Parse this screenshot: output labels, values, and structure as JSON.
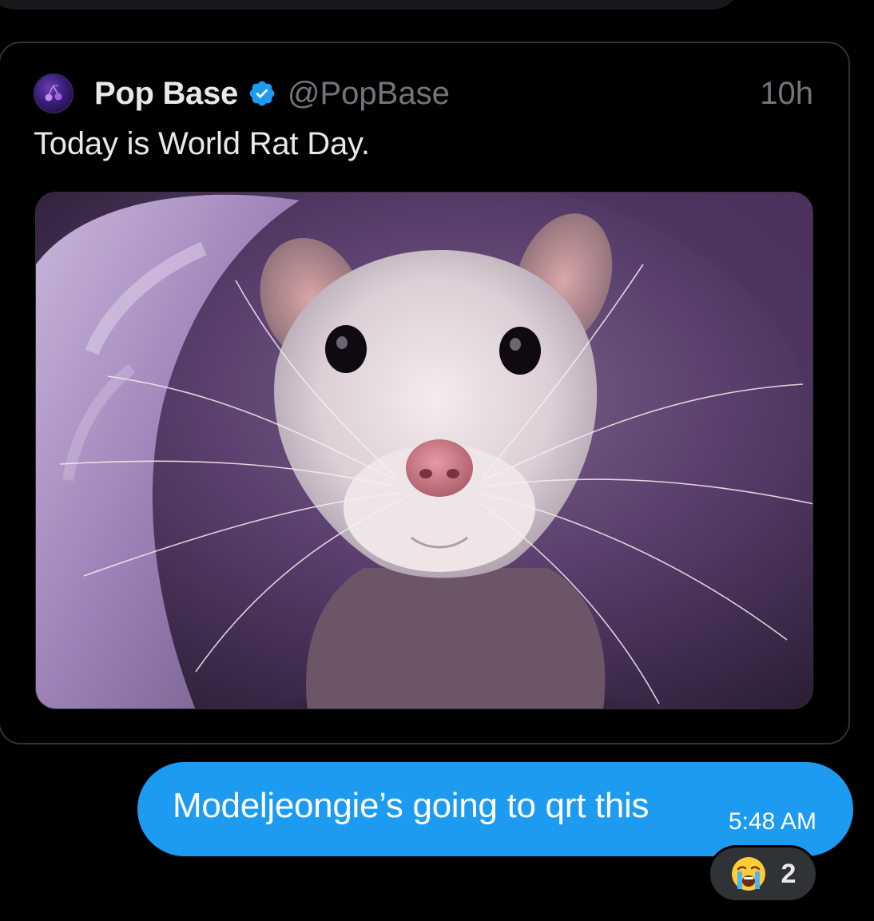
{
  "quoted_tweet": {
    "display_name": "Pop Base",
    "handle": "@PopBase",
    "time_ago": "10h",
    "text": "Today is World Rat Day.",
    "verified": true,
    "avatar_icon": "cherry-logo-icon",
    "image_description_icon": "rat-photo"
  },
  "message": {
    "text": "Modeljeongie’s going to qrt this",
    "timestamp": "5:48 AM",
    "bubble_color": "#1d9bf0"
  },
  "reaction": {
    "emoji_icon": "loudly-crying-face-icon",
    "count": "2"
  },
  "colors": {
    "background": "#000000",
    "verified_badge": "#1d9bf0",
    "secondary_text": "#71767b",
    "primary_text": "#e7e9ea"
  }
}
